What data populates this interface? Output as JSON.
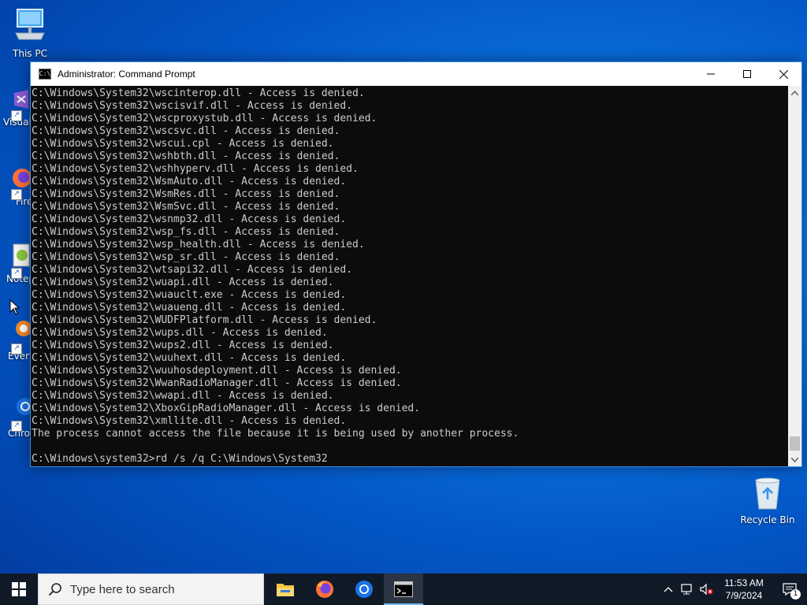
{
  "desktop": {
    "icons": [
      {
        "label": "This PC",
        "icon": "computer-icon"
      },
      {
        "label": "Visual Studio Code",
        "icon": "vscode-icon"
      },
      {
        "label": "Firefox",
        "icon": "firefox-icon"
      },
      {
        "label": "Notepad++",
        "icon": "notepadpp-icon"
      },
      {
        "label": "Everything",
        "icon": "everything-icon"
      },
      {
        "label": "Chrome",
        "icon": "chrome-icon"
      }
    ],
    "recycle_bin": {
      "label": "Recycle Bin",
      "icon": "recycle-bin-icon"
    }
  },
  "window": {
    "title": "Administrator: Command Prompt",
    "controls": {
      "minimize": "minimize",
      "maximize": "maximize",
      "close": "close"
    },
    "lines": [
      "C:\\Windows\\System32\\wscinterop.dll - Access is denied.",
      "C:\\Windows\\System32\\wscisvif.dll - Access is denied.",
      "C:\\Windows\\System32\\wscproxystub.dll - Access is denied.",
      "C:\\Windows\\System32\\wscsvc.dll - Access is denied.",
      "C:\\Windows\\System32\\wscui.cpl - Access is denied.",
      "C:\\Windows\\System32\\wshbth.dll - Access is denied.",
      "C:\\Windows\\System32\\wshhyperv.dll - Access is denied.",
      "C:\\Windows\\System32\\WsmAuto.dll - Access is denied.",
      "C:\\Windows\\System32\\WsmRes.dll - Access is denied.",
      "C:\\Windows\\System32\\WsmSvc.dll - Access is denied.",
      "C:\\Windows\\System32\\wsnmp32.dll - Access is denied.",
      "C:\\Windows\\System32\\wsp_fs.dll - Access is denied.",
      "C:\\Windows\\System32\\wsp_health.dll - Access is denied.",
      "C:\\Windows\\System32\\wsp_sr.dll - Access is denied.",
      "C:\\Windows\\System32\\wtsapi32.dll - Access is denied.",
      "C:\\Windows\\System32\\wuapi.dll - Access is denied.",
      "C:\\Windows\\System32\\wuauclt.exe - Access is denied.",
      "C:\\Windows\\System32\\wuaueng.dll - Access is denied.",
      "C:\\Windows\\System32\\WUDFPlatform.dll - Access is denied.",
      "C:\\Windows\\System32\\wups.dll - Access is denied.",
      "C:\\Windows\\System32\\wups2.dll - Access is denied.",
      "C:\\Windows\\System32\\wuuhext.dll - Access is denied.",
      "C:\\Windows\\System32\\wuuhosdeployment.dll - Access is denied.",
      "C:\\Windows\\System32\\WwanRadioManager.dll - Access is denied.",
      "C:\\Windows\\System32\\wwapi.dll - Access is denied.",
      "C:\\Windows\\System32\\XboxGipRadioManager.dll - Access is denied.",
      "C:\\Windows\\System32\\xmllite.dll - Access is denied.",
      "The process cannot access the file because it is being used by another process.",
      "",
      "C:\\Windows\\system32>rd /s /q C:\\Windows\\System32"
    ]
  },
  "taskbar": {
    "search_placeholder": "Type here to search",
    "apps": [
      "file-explorer-icon",
      "firefox-icon",
      "chrome-icon",
      "command-prompt-icon"
    ],
    "clock": {
      "time": "11:53 AM",
      "date": "7/9/2024"
    },
    "notification_count": "1"
  }
}
